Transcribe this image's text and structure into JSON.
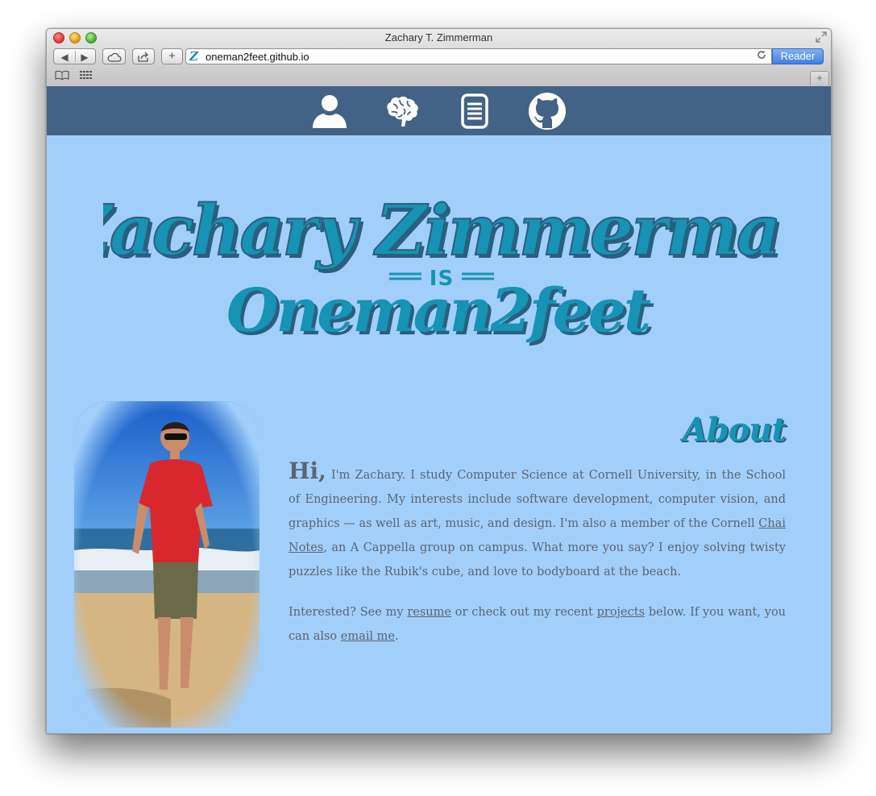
{
  "window": {
    "title": "Zachary T. Zimmerman"
  },
  "toolbar": {
    "back_icon": "back-arrow-icon",
    "forward_icon": "forward-arrow-icon",
    "url": "oneman2feet.github.io",
    "favicon_letter": "Z",
    "reader_label": "Reader"
  },
  "nav": {
    "items": [
      "person-icon",
      "brain-icon",
      "document-icon",
      "github-icon"
    ]
  },
  "header": {
    "line1": "Zachary Zimmerman",
    "connector": "IS",
    "line2": "Oneman2feet"
  },
  "about": {
    "title": "About",
    "hi": "Hi,",
    "p1_a": " I'm Zachary.   I study Computer Science at Cornell University, in the School of Engineering. My interests include software development, computer vision, and graphics — as well as art, music, and design. I'm also a member of the Cornell ",
    "chai_link": "Chai Notes",
    "p1_b": ", an A Cappella group on campus. What more you say? I enjoy solving twisty puzzles like the Rubik's cube, and love to bodyboard at the beach.",
    "p2_a": "Interested? See my ",
    "resume_link": "resume",
    "p2_b": " or check out my recent ",
    "projects_link": "projects",
    "p2_c": " below. If you want, you can also ",
    "email_link": "email me",
    "p2_d": "."
  },
  "colors": {
    "page_bg": "#a2cffa",
    "navbar_bg": "#426385",
    "logo_teal": "#1793b3",
    "logo_shadow": "#2b5f7e",
    "body_text": "#5c6472"
  }
}
